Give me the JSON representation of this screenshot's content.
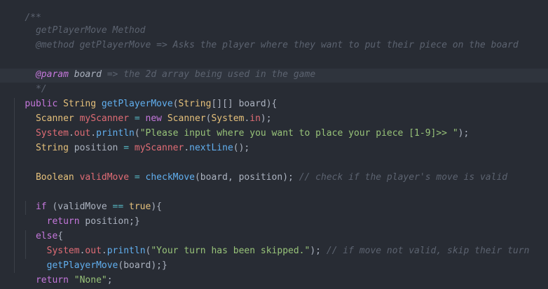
{
  "editor": {
    "theme_colors": {
      "background": "#282c34",
      "comment": "#5c6370",
      "keyword": "#c678dd",
      "type": "#e5c07b",
      "function": "#61afef",
      "string": "#98c379",
      "variable": "#e06c75",
      "operator": "#56b6c2",
      "plain": "#abb2bf"
    }
  },
  "code": {
    "l1": {
      "a": "/**"
    },
    "l2": {
      "a": "  getPlayerMove Method"
    },
    "l3": {
      "a": "  @method getPlayerMove => Asks the player where they want to put their piece on the board"
    },
    "l4": {
      "a": ""
    },
    "l5": {
      "a": "  ",
      "b": "@param",
      "c": " board",
      "d": " => the 2d array being used in the game"
    },
    "l6": {
      "a": "  */"
    },
    "l7": {
      "a": "public",
      "b": " ",
      "c": "String",
      "d": " ",
      "e": "getPlayerMove",
      "f": "(",
      "g": "String",
      "h": "[][] board){"
    },
    "l8": {
      "a": "  ",
      "b": "Scanner",
      "c": " ",
      "d": "myScanner",
      "e": " ",
      "f": "=",
      "g": " ",
      "h": "new",
      "i": " ",
      "j": "Scanner",
      "k": "(",
      "l": "System",
      "m": ".",
      "n": "in",
      "o": ");"
    },
    "l9": {
      "a": "  ",
      "b": "System",
      "c": ".",
      "d": "out",
      "e": ".",
      "f": "println",
      "g": "(",
      "h": "\"Please input where you want to place your piece [1-9]>> \"",
      "i": ");"
    },
    "l10": {
      "a": "  ",
      "b": "String",
      "c": " position ",
      "d": "=",
      "e": " ",
      "f": "myScanner",
      "g": ".",
      "h": "nextLine",
      "i": "();"
    },
    "l11": {
      "a": ""
    },
    "l12": {
      "a": "  ",
      "b": "Boolean",
      "c": " ",
      "d": "validMove",
      "e": " ",
      "f": "=",
      "g": " ",
      "h": "checkMove",
      "i": "(board, position); ",
      "j": "// check if the player's move is valid"
    },
    "l13": {
      "a": ""
    },
    "l14": {
      "a": "  ",
      "b": "if",
      "c": " (validMove ",
      "d": "==",
      "e": " ",
      "f": "true",
      "g": "){"
    },
    "l15": {
      "a": "    ",
      "b": "return",
      "c": " position;}"
    },
    "l16": {
      "a": "  ",
      "b": "else",
      "c": "{"
    },
    "l17": {
      "a": "    ",
      "b": "System",
      "c": ".",
      "d": "out",
      "e": ".",
      "f": "println",
      "g": "(",
      "h": "\"Your turn has been skipped.\"",
      "i": "); ",
      "j": "// if move not valid, skip their turn"
    },
    "l18": {
      "a": "    ",
      "b": "getPlayerMove",
      "c": "(board);}"
    },
    "l19": {
      "a": "  ",
      "b": "return",
      "c": " ",
      "d": "\"None\"",
      "e": ";"
    },
    "l20": {
      "a": "}"
    }
  }
}
